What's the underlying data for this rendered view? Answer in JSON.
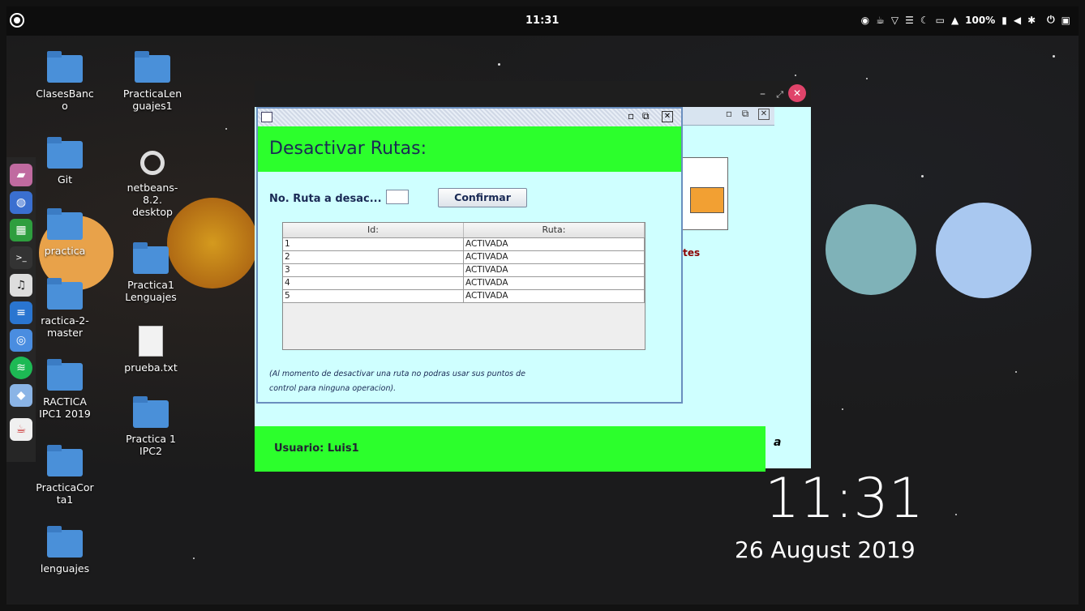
{
  "topbar": {
    "clock": "11:31",
    "battery": "100%"
  },
  "desktop": {
    "icons": [
      {
        "label": "ClasesBanc o",
        "line1": "ClasesBanc",
        "line2": "o"
      },
      {
        "label": "PracticaLen guajes1",
        "line1": "PracticaLen",
        "line2": "guajes1"
      },
      {
        "label": "Git"
      },
      {
        "label": "netbeans- 8.2. desktop",
        "line1": "netbeans-",
        "line2": "8.2.",
        "line3": "desktop"
      },
      {
        "label": "practica"
      },
      {
        "label": "Practica1 Lenguajes",
        "line1": "Practica1",
        "line2": "Lenguajes"
      },
      {
        "label": "ractica-2- master",
        "line1": "ractica-2-",
        "line2": "master"
      },
      {
        "label": "prueba.txt"
      },
      {
        "label": "RACTICA IPC1 2019",
        "line1": "RACTICA",
        "line2": "IPC1 2019"
      },
      {
        "label": "Practica 1 IPC2",
        "line1": "Practica 1",
        "line2": "IPC2"
      },
      {
        "label": "PracticaCor ta1",
        "line1": "PracticaCor",
        "line2": "ta1"
      },
      {
        "label": "lenguajes"
      }
    ],
    "big_clock": "11:31",
    "big_date": "26 August 2019"
  },
  "dock": {
    "items": [
      "files-icon",
      "settings-icon",
      "spreadsheet-icon",
      "terminal-icon",
      "music-icon",
      "writer-icon",
      "chrome-icon",
      "spotify-icon",
      "box-icon",
      "java-icon"
    ]
  },
  "back_window": {
    "reportes_label": "ortes",
    "user_label": "Usuario: Luis1",
    "side_letter": "a"
  },
  "dialog": {
    "title": "Desactivar Rutas:",
    "input_label": "No. Ruta a desac...",
    "input_value": "",
    "confirm_label": "Confirmar",
    "table": {
      "columns": [
        "Id:",
        "Ruta:"
      ],
      "rows": [
        [
          "1",
          "ACTIVADA"
        ],
        [
          "2",
          "ACTIVADA"
        ],
        [
          "3",
          "ACTIVADA"
        ],
        [
          "4",
          "ACTIVADA"
        ],
        [
          "5",
          "ACTIVADA"
        ]
      ]
    },
    "note_line1": "(Al momento de  desactivar una ruta no podras usar sus puntos de",
    "note_line2": "control para ninguna operacion)."
  },
  "colors": {
    "green_header": "#2cff2c",
    "cyan_bg": "#cfffff",
    "close_button": "#e0446a"
  }
}
